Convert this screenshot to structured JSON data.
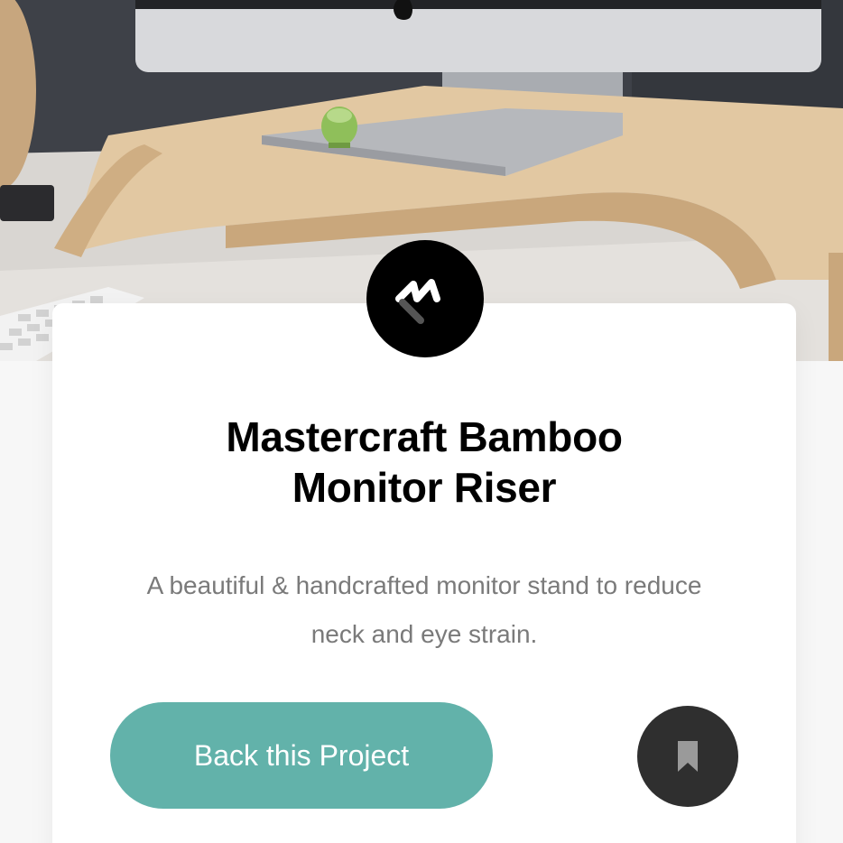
{
  "project": {
    "title_line1": "Mastercraft Bamboo",
    "title_line2": "Monitor Riser",
    "description_line1": "A beautiful & handcrafted monitor stand to reduce",
    "description_line2": "neck and eye strain."
  },
  "actions": {
    "back_label": "Back this Project",
    "bookmark_icon": "bookmark-icon"
  },
  "brand": {
    "logo_icon": "mastercraft-logo-icon"
  },
  "colors": {
    "accent": "#62b2aa",
    "dark": "#2f2f2f",
    "title": "#000000",
    "text_muted": "#7a7a7a",
    "background": "#f7f7f7"
  }
}
